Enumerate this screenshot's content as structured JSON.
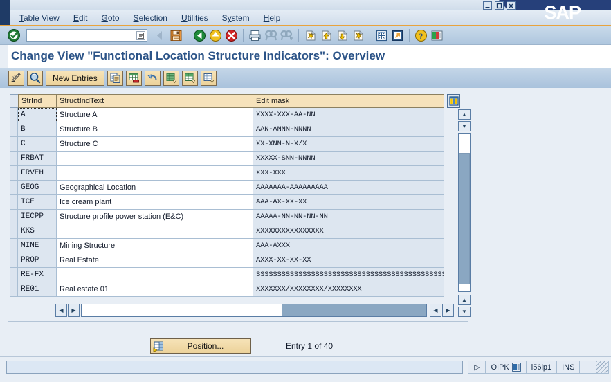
{
  "window": {
    "app_name": "SAP",
    "buttons": {
      "minimize": "–",
      "maximize": "□",
      "close": "✕"
    }
  },
  "menu": {
    "items": [
      {
        "name": "table-view",
        "label": "Table View",
        "accel": "T"
      },
      {
        "name": "edit",
        "label": "Edit",
        "accel": "E"
      },
      {
        "name": "goto",
        "label": "Goto",
        "accel": "G"
      },
      {
        "name": "selection",
        "label": "Selection",
        "accel": "S"
      },
      {
        "name": "utilities",
        "label": "Utilities",
        "accel": "U"
      },
      {
        "name": "system",
        "label": "System",
        "accel": "y"
      },
      {
        "name": "help",
        "label": "Help",
        "accel": "H"
      }
    ]
  },
  "toolbar": {
    "command_field": {
      "value": "",
      "placeholder": ""
    },
    "icons": [
      "enter-check-icon",
      "back-nav-icon",
      "save-icon",
      "back-green-icon",
      "exit-yellow-icon",
      "cancel-red-icon",
      "print-icon",
      "find-icon",
      "find-next-icon",
      "first-page-icon",
      "previous-page-icon",
      "next-page-icon",
      "last-page-icon",
      "create-session-icon",
      "create-shortcut-icon",
      "help-icon",
      "customize-local-layout-icon"
    ]
  },
  "title": {
    "text": "Change View \"Functional Location Structure Indicators\": Overview"
  },
  "app_toolbar": {
    "buttons": [
      {
        "name": "display-change-button",
        "icon": "pencil-icon",
        "label": ""
      },
      {
        "name": "check-entries-button",
        "icon": "magnifier-icon",
        "label": ""
      },
      {
        "name": "new-entries-button",
        "icon": "",
        "label": "New Entries"
      },
      {
        "name": "copy-as-button",
        "icon": "copy-icon",
        "label": ""
      },
      {
        "name": "delete-button",
        "icon": "delete-row-icon",
        "label": ""
      },
      {
        "name": "undo-button",
        "icon": "undo-icon",
        "label": ""
      },
      {
        "name": "select-all-button",
        "icon": "select-all-icon",
        "label": ""
      },
      {
        "name": "select-block-button",
        "icon": "select-block-icon",
        "label": ""
      },
      {
        "name": "deselect-all-button",
        "icon": "deselect-all-icon",
        "label": ""
      }
    ]
  },
  "table": {
    "columns": [
      {
        "key": "strind",
        "label": "StrInd"
      },
      {
        "key": "structindtext",
        "label": "StructIndText"
      },
      {
        "key": "editmask",
        "label": "Edit mask"
      }
    ],
    "config_icon": "table-settings-icon",
    "rows": [
      {
        "strind": "A",
        "structindtext": "Structure A",
        "editmask": "XXXX-XXX-AA-NN",
        "focused": true
      },
      {
        "strind": "B",
        "structindtext": "Structure B",
        "editmask": "AAN-ANNN-NNNN",
        "focused": false
      },
      {
        "strind": "C",
        "structindtext": "Structure C",
        "editmask": "XX-XNN-N-X/X",
        "focused": false
      },
      {
        "strind": "FRBAT",
        "structindtext": "",
        "editmask": "XXXXX-SNN-NNNN",
        "focused": false
      },
      {
        "strind": "FRVEH",
        "structindtext": "",
        "editmask": "XXX-XXX",
        "focused": false
      },
      {
        "strind": "GEOG",
        "structindtext": "Geographical Location",
        "editmask": "AAAAAAA-AAAAAAAAA",
        "focused": false
      },
      {
        "strind": "ICE",
        "structindtext": "Ice cream plant",
        "editmask": "AAA-AX-XX-XX",
        "focused": false
      },
      {
        "strind": "IECPP",
        "structindtext": "Structure profile power station (E&C)",
        "editmask": "AAAAA-NN-NN-NN-NN",
        "focused": false
      },
      {
        "strind": "KKS",
        "structindtext": "",
        "editmask": "XXXXXXXXXXXXXXXX",
        "focused": false
      },
      {
        "strind": "MINE",
        "structindtext": "Mining Structure",
        "editmask": "AAA-AXXX",
        "focused": false
      },
      {
        "strind": "PROP",
        "structindtext": "Real Estate",
        "editmask": "AXXX-XX-XX-XX",
        "focused": false
      },
      {
        "strind": "RE-FX",
        "structindtext": "",
        "editmask": "SSSSSSSSSSSSSSSSSSSSSSSSSSSSSSSSSSSSSSSSSSSSSS",
        "focused": false
      },
      {
        "strind": "RE01",
        "structindtext": "Real estate 01",
        "editmask": "XXXXXXX/XXXXXXXX/XXXXXXXX",
        "focused": false
      }
    ]
  },
  "footer": {
    "position_button": {
      "label": "Position...",
      "icon": "position-icon"
    },
    "entry_counter": "Entry 1 of 40"
  },
  "statusbar": {
    "message": "",
    "system_triangle": "▷",
    "program": "OIPK",
    "server_icon": "server-icon",
    "session": "i56lp1",
    "insert_mode": "INS",
    "blank": "",
    "resize_grip": "resize-grip-icon"
  },
  "colors": {
    "sap_blue": "#26407a",
    "title_blue": "#2b5387",
    "header_tan": "#f6e2bb",
    "button_tan": "#ecd29a",
    "accent_orange": "#e8a33d",
    "row_blue": "#dde6f0",
    "scrollbar_thumb": "#8aa7c2"
  }
}
